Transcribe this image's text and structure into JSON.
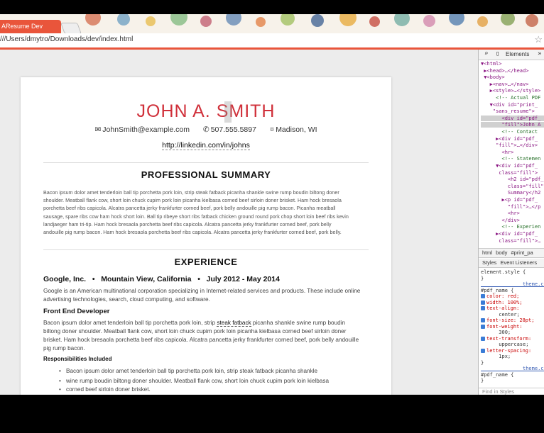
{
  "browser": {
    "tab_title": "AResume Dev",
    "address": "///Users/dmytro/Downloads/dev/index.html"
  },
  "resume": {
    "name": "JOHN A. SMITH",
    "email": "JohnSmith@example.com",
    "phone": "507.555.5897",
    "location": "Madison, WI",
    "linkedin": "http://linkedin.com/in/johns",
    "summary_title": "PROFESSIONAL SUMMARY",
    "summary_lines": [
      "Bacon ipsum dolor amet tenderloin ball tip porchetta pork loin, strip steak fatback picanha shankle swine rump boudin biltong doner",
      "shoulder. Meatball flank cow, short loin chuck cupim pork loin picanha kielbasa corned beef sirloin doner brisket. Ham hock bresaola",
      "porchetta beef ribs capicola. Alcatra pancetta jerky frankfurter corned beef, pork belly andouille pig rump bacon. Picanha meatball",
      "sausage, spare ribs cow ham hock short loin. Ball tip ribeye short ribs fatback chicken ground round pork chop short loin beef ribs kevin",
      "landjaeger ham tri-tip. Ham hock bresaola porchetta beef ribs capicola. Alcatra pancetta jerky frankfurter corned beef, pork belly",
      "andouille pig rump bacon. Ham hock bresaola porchetta beef ribs capicola. Alcatra pancetta jerky frankfurter corned beef, pork belly."
    ],
    "experience_title": "EXPERIENCE",
    "job_header": "Google, Inc.   •   Mountain View, California   •   July 2012 - May 2014",
    "company_desc_1": "Google is an American multinational corporation specializing in Internet-related services and products. These include online",
    "company_desc_2": "advertising technologies, search, cloud computing, and software.",
    "role": "Front End Developer",
    "role_desc_1a": "Bacon ipsum dolor amet tenderloin ball tip porchetta pork loin, strip ",
    "role_desc_1b": "steak fatback",
    "role_desc_1c": " picanha shankle swine rump boudin",
    "role_desc_2": "biltong doner shoulder. Meatball flank cow, short loin chuck cupim pork loin picanha kielbasa corned beef sirloin doner",
    "role_desc_3": "brisket. Ham hock bresaola porchetta beef ribs capicola. Alcatra pancetta jerky frankfurter corned beef, pork belly andouille",
    "role_desc_4": "pig rump bacon.",
    "resp_title": "Responsibilities Included",
    "bullets": [
      "Bacon ipsum dolor amet tenderloin ball tip porchetta pork loin, strip steak fatback picanha shankle",
      "wine rump boudin biltong doner shoulder. Meatball flank cow, short loin chuck cupim pork loin kielbasa",
      "corned beef sirloin doner brisket."
    ]
  },
  "devtools": {
    "tab_elements": "Elements",
    "dom_lines": [
      "▼<html>",
      " ▶<head>…</head>",
      " ▼<body>",
      "   ▶<nav>…</nav>",
      "   ▶<style>…</style>",
      "     <!-- Actual PDF",
      "   ▼<div id=\"print_",
      "    \"sans_resume\">",
      "       <div id=\"pdf_",
      "       \"fill\">John A",
      "       <!-- Contact",
      "     ▶<div id=\"pdf_",
      "     \"fill\">…</div>",
      "       <hr>",
      "       <!-- Statemen",
      "     ▼<div id=\"pdf_",
      "      class=\"fill\">",
      "         <h2 id=\"pdf_",
      "         class=\"fill\"",
      "         Summary</h2",
      "       ▶<p id=\"pdf_",
      "         \"fill\">…</p",
      "         <hr>",
      "       </div>",
      "       <!-- Experien",
      "     ▶<div id=\"pdf_",
      "      class=\"fill\">…"
    ],
    "crumbs": [
      "html",
      "body",
      "#print_pa"
    ],
    "styles_tabs": [
      "Styles",
      "Event Listeners"
    ],
    "styles_lines": [
      "element.style {",
      "}",
      "              theme.css:77",
      "#pdf_name {",
      "  color: red;",
      "  width: 100%;",
      "  text-align:",
      "      center;",
      "  font-size: 28pt;",
      "  font-weight:",
      "      300;",
      "  text-transform:",
      "      uppercase;",
      "  letter-spacing:",
      "      1px;",
      "}",
      "              theme.css:87",
      "#pdf_name {",
      "}"
    ],
    "find_placeholder": "Find in Styles"
  }
}
